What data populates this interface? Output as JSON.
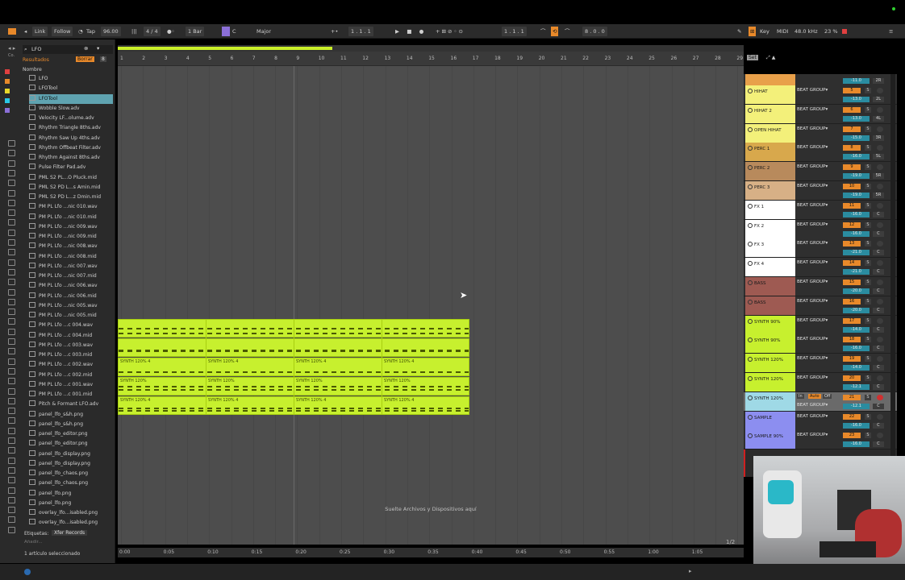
{
  "transport": {
    "link": "Link",
    "follow": "Follow",
    "tap": "Tap",
    "tempo": "96.00",
    "meter": "4 / 4",
    "quantize": "1 Bar",
    "key_root": "C",
    "scale": "Major",
    "position": "1 .   1 .   1",
    "loop_start": "1 .   1 .   1",
    "loop_len": "8 .   0 .   0",
    "key_label": "Key",
    "midi_label": "MIDI",
    "sample_rate": "48.0 kHz",
    "cpu": "23 %"
  },
  "browser": {
    "search_value": "LFO",
    "results_label": "Resultados",
    "clear_label": "Borrar",
    "count_badge": "8",
    "column_header": "Nombre",
    "files": [
      {
        "name": "LFO",
        "type": "folder"
      },
      {
        "name": "LFOTool",
        "type": "folder"
      },
      {
        "name": "LFOTool",
        "type": "folder",
        "selected": true
      },
      {
        "name": "Wobble Slow.adv",
        "type": "file"
      },
      {
        "name": "Velocity LF...olume.adv",
        "type": "file"
      },
      {
        "name": "Rhythm Triangle 8ths.adv",
        "type": "file"
      },
      {
        "name": "Rhythm Saw Up 4ths.adv",
        "type": "file"
      },
      {
        "name": "Rhythm Offbeat Filter.adv",
        "type": "file"
      },
      {
        "name": "Rhythm Against 8ths.adv",
        "type": "file"
      },
      {
        "name": "Pulse Filter Pad.adv",
        "type": "file"
      },
      {
        "name": "PML S2 PL...O Pluck.mid",
        "type": "file"
      },
      {
        "name": "PML S2 PD L...s Amin.mid",
        "type": "file"
      },
      {
        "name": "PML S2 PD L...z Dmin.mid",
        "type": "file"
      },
      {
        "name": "PM PL Lfo ...nic 010.wav",
        "type": "file"
      },
      {
        "name": "PM PL Lfo ...nic 010.mid",
        "type": "file"
      },
      {
        "name": "PM PL Lfo ...nic 009.wav",
        "type": "file"
      },
      {
        "name": "PM PL Lfo ...nic 009.mid",
        "type": "file"
      },
      {
        "name": "PM PL Lfo ...nic 008.wav",
        "type": "file"
      },
      {
        "name": "PM PL Lfo ...nic 008.mid",
        "type": "file"
      },
      {
        "name": "PM PL Lfo ...nic 007.wav",
        "type": "file"
      },
      {
        "name": "PM PL Lfo ...nic 007.mid",
        "type": "file"
      },
      {
        "name": "PM PL Lfo ...nic 006.wav",
        "type": "file"
      },
      {
        "name": "PM PL Lfo ...nic 006.mid",
        "type": "file"
      },
      {
        "name": "PM PL Lfo ...nic 005.wav",
        "type": "file"
      },
      {
        "name": "PM PL Lfo ...nic 005.mid",
        "type": "file"
      },
      {
        "name": "PM PL Lfo ...c 004.wav",
        "type": "file"
      },
      {
        "name": "PM PL Lfo ...c 004.mid",
        "type": "file"
      },
      {
        "name": "PM PL Lfo ...c 003.wav",
        "type": "file"
      },
      {
        "name": "PM PL Lfo ...c 003.mid",
        "type": "file"
      },
      {
        "name": "PM PL Lfo ...c 002.wav",
        "type": "file"
      },
      {
        "name": "PM PL Lfo ...c 002.mid",
        "type": "file"
      },
      {
        "name": "PM PL Lfo ...c 001.wav",
        "type": "file"
      },
      {
        "name": "PM PL Lfo ...c 001.mid",
        "type": "file"
      },
      {
        "name": "Pitch & Formant LFO.adv",
        "type": "file"
      },
      {
        "name": "panel_lfo_s&h.png",
        "type": "file"
      },
      {
        "name": "panel_lfo_s&h.png",
        "type": "file"
      },
      {
        "name": "panel_lfo_editor.png",
        "type": "file"
      },
      {
        "name": "panel_lfo_editor.png",
        "type": "file"
      },
      {
        "name": "panel_lfo_display.png",
        "type": "file"
      },
      {
        "name": "panel_lfo_display.png",
        "type": "file"
      },
      {
        "name": "panel_lfo_chaos.png",
        "type": "file"
      },
      {
        "name": "panel_lfo_chaos.png",
        "type": "file"
      },
      {
        "name": "panel_lfo.png",
        "type": "file"
      },
      {
        "name": "panel_lfo.png",
        "type": "file"
      },
      {
        "name": "overlay_lfo...isabled.png",
        "type": "file"
      },
      {
        "name": "overlay_lfo...isabled.png",
        "type": "file"
      }
    ],
    "tags_label": "Etiquetas:",
    "tag_value": "Xfer Records",
    "add_label": "Añadir...",
    "status": "1 artículo seleccionado"
  },
  "ruler": {
    "bars": [
      "1",
      "2",
      "3",
      "4",
      "5",
      "6",
      "7",
      "8",
      "9",
      "10",
      "11",
      "12",
      "13",
      "14",
      "15",
      "16",
      "17",
      "18",
      "19",
      "20",
      "21",
      "22",
      "23",
      "24",
      "25",
      "26",
      "27",
      "28",
      "29"
    ],
    "set_label": "Set"
  },
  "time_marks": [
    "0:00",
    "0:05",
    "0:10",
    "0:15",
    "0:20",
    "0:25",
    "0:30",
    "0:35",
    "0:40",
    "0:45",
    "0:50",
    "0:55",
    "1:00",
    "1:05"
  ],
  "drop_hint": "Suelte Archivos y Dispositivos aquí",
  "page_indicator": "1/2",
  "clips": [
    {
      "row": 0,
      "label": ""
    },
    {
      "row": 1,
      "label": ""
    },
    {
      "row": 2,
      "label": "SYNTH 120% 4"
    },
    {
      "row": 3,
      "label": "SYNTH 120%"
    },
    {
      "row": 4,
      "label": "SYNTH 120% 4"
    }
  ],
  "tracks": [
    {
      "name": "HIHAT",
      "group": "BEAT GROUP",
      "num": "5",
      "vol": "-13.0",
      "pan": "2L",
      "color": "#f3f07a"
    },
    {
      "name": "HIHAT 2",
      "group": "BEAT GROUP",
      "num": "6",
      "vol": "-13.0",
      "pan": "4L",
      "color": "#f3f07a"
    },
    {
      "name": "OPEN HIHAT",
      "group": "BEAT GROUP",
      "num": "7",
      "vol": "-15.0",
      "pan": "3R",
      "color": "#f3f07a"
    },
    {
      "name": "PERC 1",
      "group": "BEAT GROUP",
      "num": "8",
      "vol": "-16.0",
      "pan": "5L",
      "color": "#d8a84c"
    },
    {
      "name": "PERC 2",
      "group": "BEAT GROUP",
      "num": "9",
      "vol": "-19.0",
      "pan": "5R",
      "color": "#b88a5c"
    },
    {
      "name": "PERC 3",
      "group": "BEAT GROUP",
      "num": "10",
      "vol": "-19.0",
      "pan": "5R",
      "color": "#d7b086"
    },
    {
      "name": "FX 1",
      "group": "BEAT GROUP",
      "num": "11",
      "vol": "-16.0",
      "pan": "C",
      "color": "#ffffff"
    },
    {
      "name": "FX 2",
      "group": "BEAT GROUP",
      "num": "12",
      "vol": "-16.0",
      "pan": "C",
      "color": "#ffffff"
    },
    {
      "name": "FX 3",
      "group": "BEAT GROUP",
      "num": "13",
      "vol": "-21.0",
      "pan": "C",
      "color": "#ffffff"
    },
    {
      "name": "FX 4",
      "group": "BEAT GROUP",
      "num": "14",
      "vol": "-21.0",
      "pan": "C",
      "color": "#ffffff"
    },
    {
      "name": "BASS",
      "group": "BEAT GROUP",
      "num": "15",
      "vol": "-20.0",
      "pan": "C",
      "color": "#9e5a52"
    },
    {
      "name": "BASS",
      "group": "BEAT GROUP",
      "num": "16",
      "vol": "-20.0",
      "pan": "C",
      "color": "#9e5a52"
    },
    {
      "name": "SYNTH 90%",
      "group": "BEAT GROUP",
      "num": "17",
      "vol": "-14.0",
      "pan": "C",
      "color": "#c7f02e"
    },
    {
      "name": "SYNTH 90%",
      "group": "BEAT GROUP",
      "num": "18",
      "vol": "-16.0",
      "pan": "C",
      "color": "#c7f02e"
    },
    {
      "name": "SYNTH 120%",
      "group": "BEAT GROUP",
      "num": "19",
      "vol": "-14.0",
      "pan": "C",
      "color": "#c7f02e"
    },
    {
      "name": "SYNTH 120%",
      "group": "BEAT GROUP",
      "num": "20",
      "vol": "-12.1",
      "pan": "C",
      "color": "#c7f02e"
    },
    {
      "name": "SYNTH 120%",
      "group": "BEAT GROUP",
      "num": "21",
      "vol": "-12.1",
      "pan": "C",
      "color": "#9fd9e6",
      "selected": true,
      "monitor_in": "In",
      "monitor_auto": "Auto",
      "monitor_off": "Off"
    },
    {
      "name": "SAMPLE",
      "group": "BEAT GROUP",
      "num": "22",
      "vol": "-16.0",
      "pan": "C",
      "color": "#8c8ef0"
    },
    {
      "name": "SAMPLE 90%",
      "group": "BEAT GROUP",
      "num": "23",
      "vol": "-16.0",
      "pan": "C",
      "color": "#8c8ef0"
    }
  ],
  "top_track_vol": "-11.0",
  "top_track_pan": "2R",
  "colors": {
    "accent": "#e8892a",
    "clip": "#c7f02e",
    "selection": "#5fa3b0",
    "record": "#d02020"
  }
}
